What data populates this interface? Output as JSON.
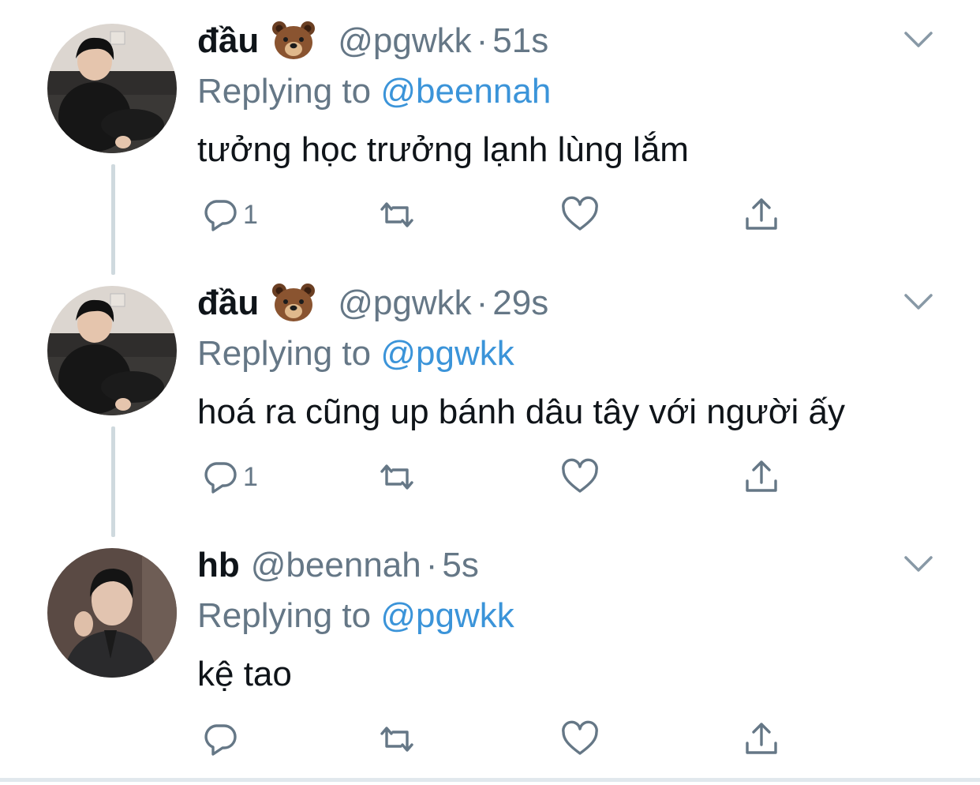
{
  "tweets": [
    {
      "name": "đầu",
      "handle": "@pgwkk",
      "dot": "·",
      "time": "51s",
      "replying_prefix": "Replying to",
      "replying_to": "@beennah",
      "text": "tưởng học trưởng lạnh lùng lắm",
      "reply_count": "1",
      "avatar": "person-black-sweater-on-sofa",
      "emoji": "bear-face-emoji"
    },
    {
      "name": "đầu",
      "handle": "@pgwkk",
      "dot": "·",
      "time": "29s",
      "replying_prefix": "Replying to",
      "replying_to": "@pgwkk",
      "text": "hoá ra cũng up bánh dâu tây với người ấy",
      "reply_count": "1",
      "avatar": "person-black-sweater-on-sofa",
      "emoji": "bear-face-emoji"
    },
    {
      "name": "hb",
      "handle": "@beennah",
      "dot": "·",
      "time": "5s",
      "replying_prefix": "Replying to",
      "replying_to": "@pgwkk",
      "text": "kệ tao",
      "reply_count": "",
      "avatar": "man-dark-suit-portrait",
      "emoji": ""
    }
  ],
  "icons": {
    "reply": "reply-icon",
    "retweet": "retweet-icon",
    "like": "heart-icon",
    "share": "share-icon",
    "more": "chevron-down-icon"
  },
  "colors": {
    "text": "#0f1419",
    "muted": "#657786",
    "link": "#3b94d9",
    "thread_line": "#cfd9de"
  }
}
